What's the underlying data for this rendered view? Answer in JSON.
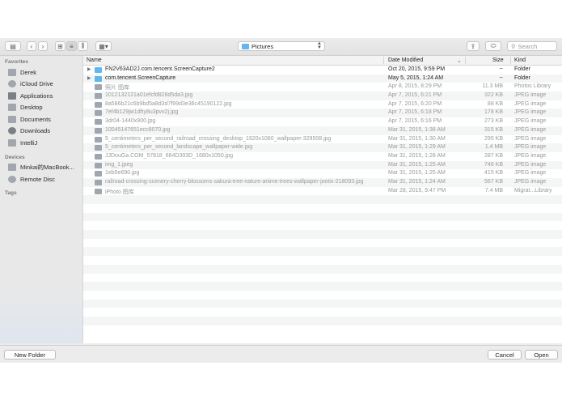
{
  "toolbar": {
    "location": "Pictures",
    "search_placeholder": "Search"
  },
  "sidebar": {
    "favorites_header": "Favorites",
    "favorites": [
      {
        "label": "Derek",
        "icon": "home-icon"
      },
      {
        "label": "iCloud Drive",
        "icon": "cloud-icon"
      },
      {
        "label": "Applications",
        "icon": "applications-icon"
      },
      {
        "label": "Desktop",
        "icon": "desktop-icon"
      },
      {
        "label": "Documents",
        "icon": "documents-icon"
      },
      {
        "label": "Downloads",
        "icon": "downloads-icon"
      },
      {
        "label": "IntelliJ",
        "icon": "folder-icon"
      }
    ],
    "devices_header": "Devices",
    "devices": [
      {
        "label": "Minkai的MacBook...",
        "icon": "laptop-icon"
      },
      {
        "label": "Remote Disc",
        "icon": "disc-icon"
      }
    ],
    "tags_header": "Tags"
  },
  "columns": {
    "name": "Name",
    "date": "Date Modified",
    "size": "Size",
    "kind": "Kind"
  },
  "files": [
    {
      "name": "FN2V63AD2J.com.tencent.ScreenCapture2",
      "date": "Oct 20, 2015, 9:59 PM",
      "size": "--",
      "kind": "Folder",
      "folder": true
    },
    {
      "name": "com.tencent.ScreenCapture",
      "date": "May 5, 2015, 1:24 AM",
      "size": "--",
      "kind": "Folder",
      "folder": true
    },
    {
      "name": "照片 图库",
      "date": "Apr 8, 2015, 8:29 PM",
      "size": "11.3 MB",
      "kind": "Photos Library",
      "folder": false
    },
    {
      "name": "1012132121a01efcfd828d5da3.jpg",
      "date": "Apr 7, 2015, 6:21 PM",
      "size": "322 KB",
      "kind": "JPEG image",
      "folder": false
    },
    {
      "name": "8a586b21c6b9bd5a8d3d7f99d3e36c45190122.jpg",
      "date": "Apr 7, 2015, 6:20 PM",
      "size": "88 KB",
      "kind": "JPEG image",
      "folder": false
    },
    {
      "name": "7ef4b129jw1dhy8u3pvv2j.jpg",
      "date": "Apr 7, 2015, 6:18 PM",
      "size": "178 KB",
      "kind": "JPEG image",
      "folder": false
    },
    {
      "name": "3dr04-1440x900.jpg",
      "date": "Apr 7, 2015, 6:16 PM",
      "size": "273 KB",
      "kind": "JPEG image",
      "folder": false
    },
    {
      "name": "10045147651ecc8070.jpg",
      "date": "Mar 31, 2015, 1:38 AM",
      "size": "315 KB",
      "kind": "JPEG image",
      "folder": false
    },
    {
      "name": "5_centimeters_per_second_railroad_crossing_desktop_1920x1080_wallpaper-329508.jpg",
      "date": "Mar 31, 2015, 1:30 AM",
      "size": "295 KB",
      "kind": "JPEG image",
      "folder": false
    },
    {
      "name": "5_centimeters_per_second_landscape_wallpaper-wide.jpg",
      "date": "Mar 31, 2015, 1:29 AM",
      "size": "1.4 MB",
      "kind": "JPEG image",
      "folder": false
    },
    {
      "name": "JJDouGa.COM_57818_664D393D_1680x1050.jpg",
      "date": "Mar 31, 2015, 1:28 AM",
      "size": "287 KB",
      "kind": "JPEG image",
      "folder": false
    },
    {
      "name": "img_1.jpeg",
      "date": "Mar 31, 2015, 1:25 AM",
      "size": "746 KB",
      "kind": "JPEG image",
      "folder": false
    },
    {
      "name": "1eb5e690.jpg",
      "date": "Mar 31, 2015, 1:25 AM",
      "size": "415 KB",
      "kind": "JPEG image",
      "folder": false
    },
    {
      "name": "railroad-crossing-scenery-cherry-blossoms-sakura-tree-nature-anime-trees-wallpaper-jootix-218093.jpg",
      "date": "Mar 31, 2015, 1:24 AM",
      "size": "567 KB",
      "kind": "JPEG image",
      "folder": false
    },
    {
      "name": "iPhoto 图库",
      "date": "Mar 28, 2015, 9:47 PM",
      "size": "7.4 MB",
      "kind": "Migrat...Library",
      "folder": false
    }
  ],
  "buttons": {
    "new_folder": "New Folder",
    "cancel": "Cancel",
    "open": "Open"
  }
}
